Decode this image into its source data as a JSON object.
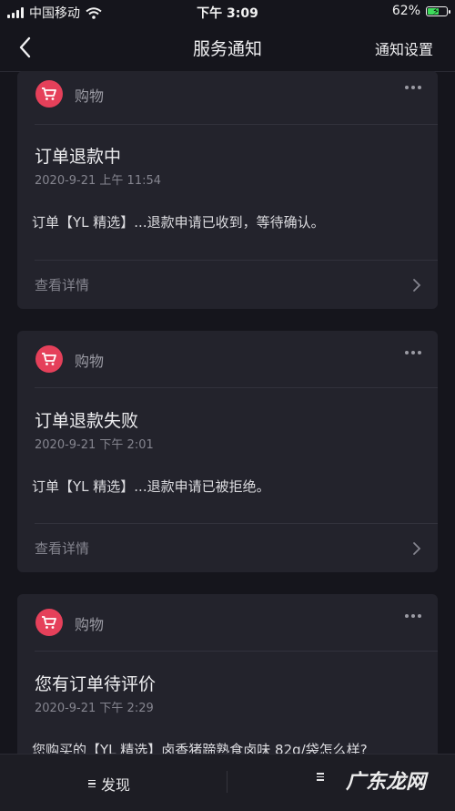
{
  "status_bar": {
    "carrier": "中国移动",
    "time": "下午 3:09",
    "battery": "62%",
    "battery_level": 0.62
  },
  "nav": {
    "title": "服务通知",
    "right_label": "通知设置"
  },
  "cards": [
    {
      "category": "购物",
      "title": "订单退款中",
      "time": "2020-9-21 上午 11:54",
      "body": "订单【YL 精选】...退款申请已收到，等待确认。",
      "detail_label": "查看详情"
    },
    {
      "category": "购物",
      "title": "订单退款失败",
      "time": "2020-9-21 下午 2:01",
      "body": "订单【YL 精选】...退款申请已被拒绝。",
      "detail_label": "查看详情"
    },
    {
      "category": "购物",
      "title": "您有订单待评价",
      "time": "2020-9-21 下午 2:29",
      "body": "您购买的【YL 精选】卤香猪蹄熟食卤味 82g/袋怎么样?"
    }
  ],
  "bottom_bar": {
    "tab_discover": "发现",
    "watermark": "广东龙网"
  },
  "colors": {
    "background": "#15151c",
    "card": "#23232c",
    "cart_badge": "#e5405a",
    "battery": "#3ddc5b"
  },
  "icons": [
    "signal-icon",
    "wifi-icon",
    "battery-icon",
    "back-chevron-icon",
    "cart-icon",
    "more-icon",
    "chevron-right-icon",
    "menu-icon"
  ]
}
